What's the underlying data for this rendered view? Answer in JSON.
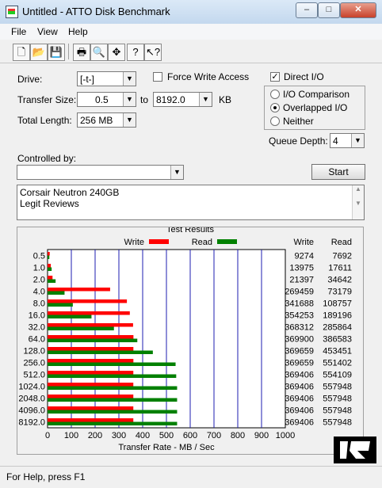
{
  "window": {
    "title": "Untitled - ATTO Disk Benchmark",
    "minimize": "–",
    "maximize": "□",
    "close": "✕"
  },
  "menu": [
    "File",
    "View",
    "Help"
  ],
  "toolbar": {
    "icons": [
      "new-icon",
      "open-icon",
      "save-icon",
      "print-icon",
      "print-preview-icon",
      "move-icon",
      "help-icon",
      "context-help-icon"
    ],
    "glyphs": [
      "🗋",
      "📂",
      "💾",
      "🖶",
      "🔍",
      "✥",
      "?",
      "↖?"
    ]
  },
  "form": {
    "drive_label": "Drive:",
    "drive_value": "[-t-]",
    "force_write_label": "Force Write Access",
    "direct_io_label": "Direct I/O",
    "direct_io_checked": true,
    "transfer_size_label": "Transfer Size:",
    "transfer_from": "0.5",
    "to_label": "to",
    "transfer_to": "8192.0",
    "kb_label": "KB",
    "total_length_label": "Total Length:",
    "total_length_value": "256 MB",
    "io_comparison_label": "I/O Comparison",
    "overlapped_io_label": "Overlapped I/O",
    "neither_label": "Neither",
    "selected_mode": "Overlapped I/O",
    "queue_depth_label": "Queue Depth:",
    "queue_depth_value": "4",
    "controlled_by_label": "Controlled by:",
    "controlled_by_value": "",
    "start_label": "Start",
    "description": [
      "Corsair Neutron 240GB",
      "Legit Reviews"
    ]
  },
  "results": {
    "title": "Test Results",
    "write_legend": "Write",
    "read_legend": "Read",
    "write_header": "Write",
    "read_header": "Read"
  },
  "chart_data": {
    "type": "bar",
    "categories": [
      "0.5",
      "1.0",
      "2.0",
      "4.0",
      "8.0",
      "16.0",
      "32.0",
      "64.0",
      "128.0",
      "256.0",
      "512.0",
      "1024.0",
      "2048.0",
      "4096.0",
      "8192.0"
    ],
    "series": [
      {
        "name": "Write",
        "color": "#ff0000",
        "values": [
          9274,
          13975,
          21397,
          269459,
          341688,
          354253,
          368312,
          369900,
          369659,
          369659,
          369406,
          369406,
          369406,
          369406,
          369406
        ]
      },
      {
        "name": "Read",
        "color": "#008000",
        "values": [
          7692,
          17611,
          34642,
          73179,
          108757,
          189196,
          285864,
          386583,
          453451,
          551402,
          554109,
          557948,
          557948,
          557948,
          557948
        ]
      }
    ],
    "xlabel": "Transfer Rate - MB / Sec",
    "xticks": [
      "0",
      "100",
      "200",
      "300",
      "400",
      "500",
      "600",
      "700",
      "800",
      "900",
      "1000"
    ],
    "xlim": [
      0,
      1000
    ],
    "value_unit_note": "table values in KB/s; bars in MB/s"
  },
  "status": {
    "text": "For Help, press F1"
  },
  "watermark": {
    "text": "LR"
  }
}
